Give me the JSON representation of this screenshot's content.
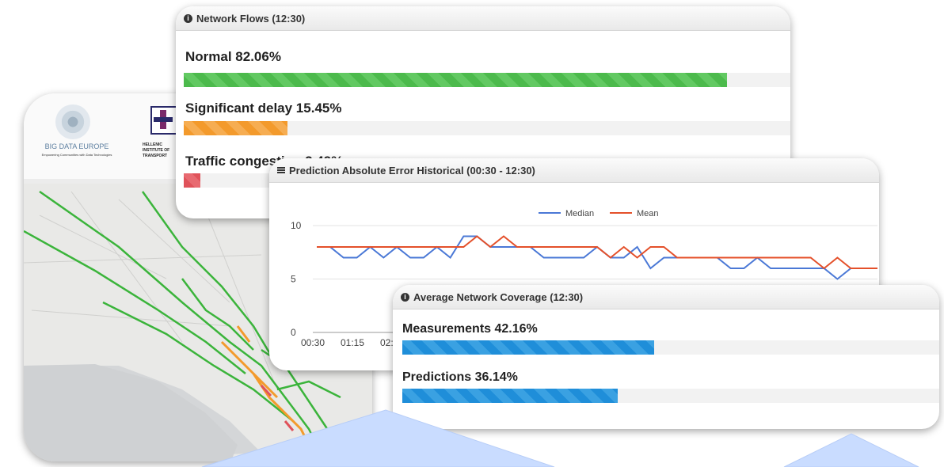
{
  "background_panel": {
    "logo1_name": "BIG DATA EUROPE",
    "logo1_tagline": "Empowering Communities with Data Technologies",
    "logo2_name": "HELLENIC INSTITUTE OF TRANSPORT"
  },
  "network_flows": {
    "title": "Network Flows (12:30)",
    "items": [
      {
        "label": "Normal 82.06%",
        "percent": 82.06,
        "color": "#4cba4c"
      },
      {
        "label": "Significant delay 15.45%",
        "percent": 15.45,
        "color": "#f39a2c"
      },
      {
        "label": "Traffic congestion 2.49%",
        "percent": 2.49,
        "color": "#e0525a"
      }
    ]
  },
  "prediction_chart": {
    "title": "Prediction Absolute Error Historical (00:30 - 12:30)",
    "chart_data": {
      "type": "line",
      "title": "Prediction Absolute Error Historical (00:30 - 12:30)",
      "x_tick_labels": [
        "00:30",
        "01:15",
        "02:00"
      ],
      "y_ticks": [
        0,
        5,
        10
      ],
      "ylim": [
        0,
        10
      ],
      "legend_position": "top",
      "series": [
        {
          "name": "Median",
          "color": "#4a78d6",
          "values": [
            8,
            8,
            7,
            7,
            8,
            7,
            8,
            7,
            7,
            8,
            7,
            9,
            9,
            8,
            8,
            8,
            8,
            7,
            7,
            7,
            7,
            8,
            7,
            7,
            8,
            6,
            7,
            7,
            7,
            7,
            7,
            6,
            6,
            7,
            6,
            6,
            6,
            6,
            6,
            5,
            6,
            6,
            6
          ]
        },
        {
          "name": "Mean",
          "color": "#e4502a",
          "values": [
            8,
            8,
            8,
            8,
            8,
            8,
            8,
            8,
            8,
            8,
            8,
            8,
            9,
            8,
            9,
            8,
            8,
            8,
            8,
            8,
            8,
            8,
            7,
            8,
            7,
            8,
            8,
            7,
            7,
            7,
            7,
            7,
            7,
            7,
            7,
            7,
            7,
            7,
            6,
            7,
            6,
            6,
            6
          ]
        }
      ]
    }
  },
  "coverage": {
    "title": "Average Network Coverage (12:30)",
    "items": [
      {
        "label": "Measurements 42.16%",
        "percent": 42.16
      },
      {
        "label": "Predictions 36.14%",
        "percent": 36.14
      }
    ]
  }
}
